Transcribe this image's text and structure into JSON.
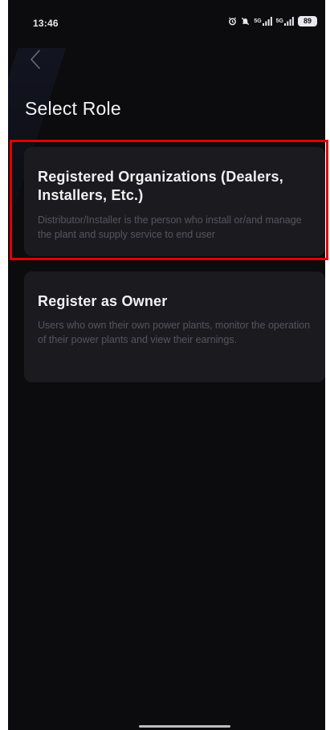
{
  "status_bar": {
    "time": "13:46",
    "network_1": "5G",
    "network_2": "5G",
    "battery": "89",
    "icons": [
      "alarm-icon",
      "mute-icon",
      "signal-icon",
      "signal-icon",
      "battery-icon"
    ]
  },
  "nav": {
    "back_icon": "chevron-left-icon"
  },
  "page": {
    "title": "Select Role"
  },
  "roles": [
    {
      "title": "Registered Organizations (Dealers, Installers, Etc.)",
      "description": "Distributor/Installer is the person who install or/and manage the plant and supply service to end user"
    },
    {
      "title": "Register as Owner",
      "description": "Users who own their own power plants, monitor the operation of their power plants and view their earnings."
    }
  ],
  "colors": {
    "background": "#0c0c0e",
    "card": "#1b1b1f",
    "highlight": "#e00000",
    "title_text": "#f2f2f5",
    "desc_text": "#55555c"
  }
}
